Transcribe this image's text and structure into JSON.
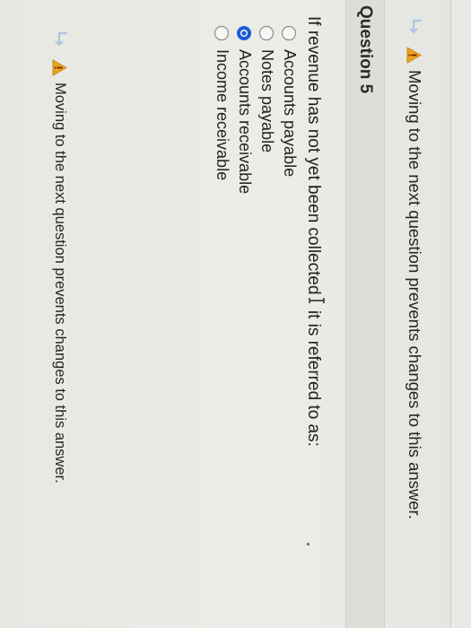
{
  "header": {
    "status_text": "..."
  },
  "warnings": {
    "top": "Moving to the next question prevents changes to this answer.",
    "bottom": "Moving to the next question prevents changes to this answer."
  },
  "question": {
    "title": "Question 5",
    "prompt_before": "If revenue has not yet been collected",
    "prompt_after": " it is referred to as:",
    "options": [
      {
        "label": "Accounts payable",
        "selected": false
      },
      {
        "label": "Notes payable",
        "selected": false
      },
      {
        "label": "Accounts receivable",
        "selected": true
      },
      {
        "label": "Income receivable",
        "selected": false
      }
    ]
  },
  "colors": {
    "radio_selected": "#1c5bd8",
    "warning_icon": "#e8a51c",
    "arrow_icon": "#a9c7df"
  },
  "icons": {
    "arrow": "return-arrow-icon",
    "warning": "warning-triangle-icon",
    "cursor": "text-cursor-icon"
  }
}
